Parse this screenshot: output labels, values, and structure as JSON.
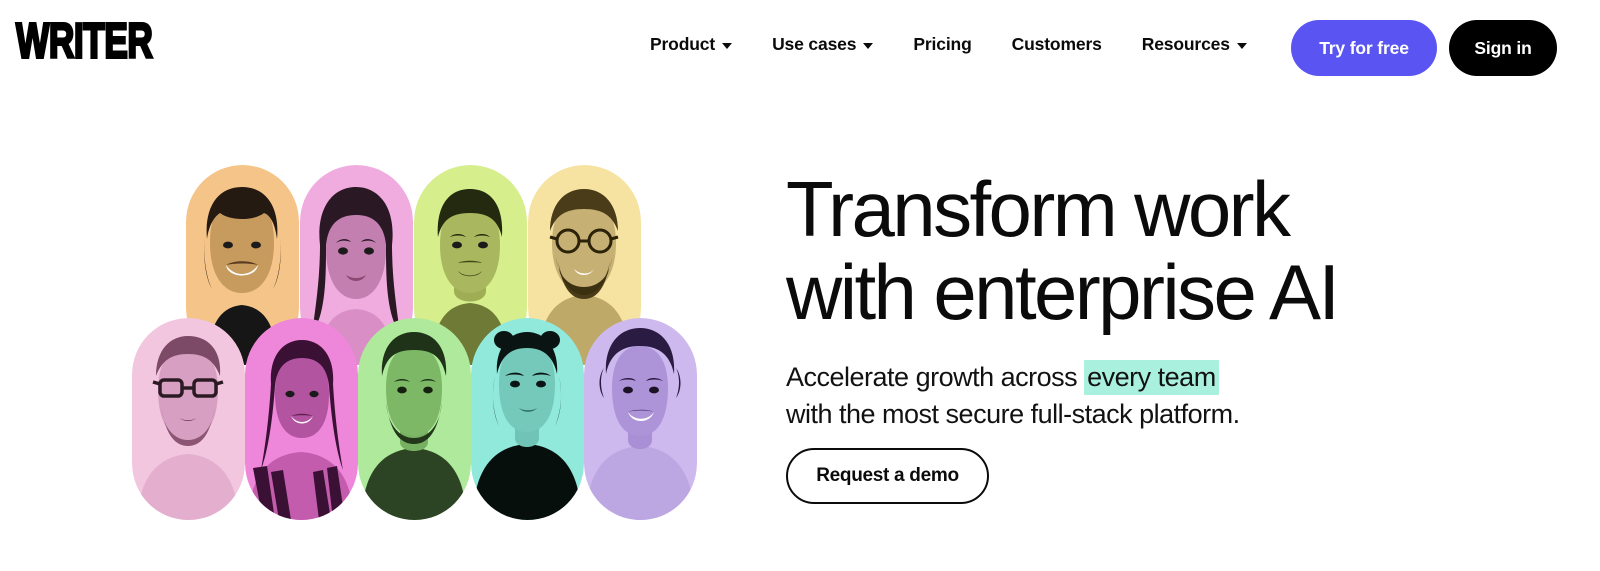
{
  "brand": {
    "logo_text": "WRITER"
  },
  "header": {
    "nav": [
      {
        "label": "Product",
        "has_dropdown": true,
        "icon": "chevron-down-icon"
      },
      {
        "label": "Use cases",
        "has_dropdown": true,
        "icon": "chevron-down-icon"
      },
      {
        "label": "Pricing",
        "has_dropdown": false,
        "icon": ""
      },
      {
        "label": "Customers",
        "has_dropdown": false,
        "icon": ""
      },
      {
        "label": "Resources",
        "has_dropdown": true,
        "icon": "chevron-down-icon"
      }
    ],
    "cta_primary": "Try for free",
    "cta_secondary": "Sign in"
  },
  "hero": {
    "headline_line1": "Transform work",
    "headline_line2": "with enterprise AI",
    "subhead_before": "Accelerate growth across ",
    "subhead_highlight": "every team",
    "subhead_after": "",
    "subhead_line2": "with the most secure full-stack platform.",
    "cta": "Request a demo"
  },
  "colors": {
    "accent_purple": "#5A55F2",
    "black": "#000000",
    "white": "#FFFFFF",
    "highlight_mint": "#A9F0DF",
    "text": "#0B0B0B"
  },
  "collage": {
    "description": "Nine duotone portrait photos in pill/arch shapes arranged in two overlapping rows",
    "back_row": [
      {
        "name": "portrait-smiling-woman-short-hair",
        "tint": "#F5C488",
        "shadow": "#8A6430"
      },
      {
        "name": "portrait-woman-long-dark-hair",
        "tint": "#F0ABDF",
        "shadow": "#7A3A68"
      },
      {
        "name": "portrait-young-man-smiling",
        "tint": "#D6EE8C",
        "shadow": "#4C5A22"
      },
      {
        "name": "portrait-man-glasses-beard",
        "tint": "#F7E3A1",
        "shadow": "#7C6A2E"
      }
    ],
    "front_row": [
      {
        "name": "portrait-man-glasses-beard-pink",
        "tint": "#F3C6DF",
        "shadow": "#7C4A66"
      },
      {
        "name": "portrait-woman-braids-magenta",
        "tint": "#EE86DA",
        "shadow": "#5A1E50"
      },
      {
        "name": "portrait-bearded-man-green",
        "tint": "#AFE99B",
        "shadow": "#27401C"
      },
      {
        "name": "portrait-woman-buns-cyan",
        "tint": "#90E9DA",
        "shadow": "#07100E"
      },
      {
        "name": "portrait-smiling-woman-lavender",
        "tint": "#CDB9EE",
        "shadow": "#46356A"
      }
    ]
  }
}
